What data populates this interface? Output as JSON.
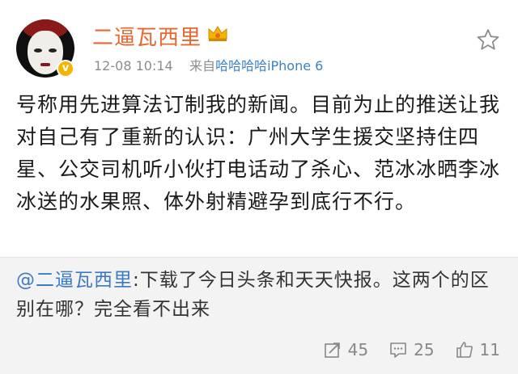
{
  "user": {
    "name": "二逼瓦西里",
    "verified_badge": "v",
    "time": "12-08 10:14",
    "source_prefix": "来自",
    "source": "哈哈哈哈iPhone 6"
  },
  "post": {
    "text": "号称用先进算法订制我的新闻。目前为止的推送让我对自己有了重新的认识：广州大学生援交坚持住四星、公交司机听小伙打电话动了杀心、范冰冰晒李冰冰送的水果照、体外射精避孕到底行不行。"
  },
  "repost": {
    "mention": "@二逼瓦西里",
    "text": ":下载了今日头条和天天快报。这两个的区别在哪？完全看不出来"
  },
  "actions": {
    "repost_count": "45",
    "comment_count": "25",
    "like_count": "11"
  },
  "icons": {
    "crown": "crown-icon",
    "star": "star-icon",
    "repost": "repost-icon",
    "comment": "comment-icon",
    "like": "thumbs-up-icon"
  },
  "colors": {
    "username": "#e8672e",
    "link": "#3b7bc6",
    "repost_bg": "#f3f3f3",
    "badge": "#f4b400"
  }
}
